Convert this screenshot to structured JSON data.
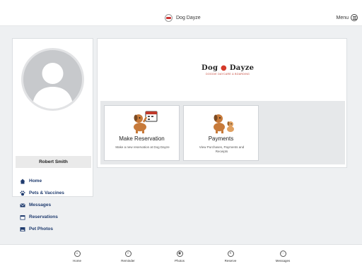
{
  "header": {
    "title": "Dog Dayze",
    "menu_label": "Menu"
  },
  "sidebar": {
    "user_name": "Robert Smith",
    "items": [
      {
        "label": "Home",
        "icon": "home-icon"
      },
      {
        "label": "Pets & Vaccines",
        "icon": "paw-icon"
      },
      {
        "label": "Messages",
        "icon": "envelope-icon"
      },
      {
        "label": "Reservations",
        "icon": "calendar-icon"
      },
      {
        "label": "Pet Photos",
        "icon": "photo-icon"
      }
    ]
  },
  "main": {
    "brand": {
      "name_part1": "Dog",
      "name_part2": "Dayze",
      "tagline": "DOGGIE DAYCARE & BOARDING"
    },
    "cards": [
      {
        "title": "Make Reservation",
        "description": "Make a new reservation at Dog Dayze"
      },
      {
        "title": "Payments",
        "description": "View Purchases, Payments and Receipts"
      }
    ]
  },
  "bottom_nav": [
    {
      "label": "Home",
      "icon": "home-icon"
    },
    {
      "label": "Reminder",
      "icon": "bell-icon"
    },
    {
      "label": "Photos",
      "icon": "camera-icon"
    },
    {
      "label": "Reserve",
      "icon": "plus-icon"
    },
    {
      "label": "Messages",
      "icon": "chat-icon"
    }
  ],
  "colors": {
    "nav_text": "#1f3b6e",
    "accent_red": "#d43a2a",
    "background": "#eef0f2"
  }
}
